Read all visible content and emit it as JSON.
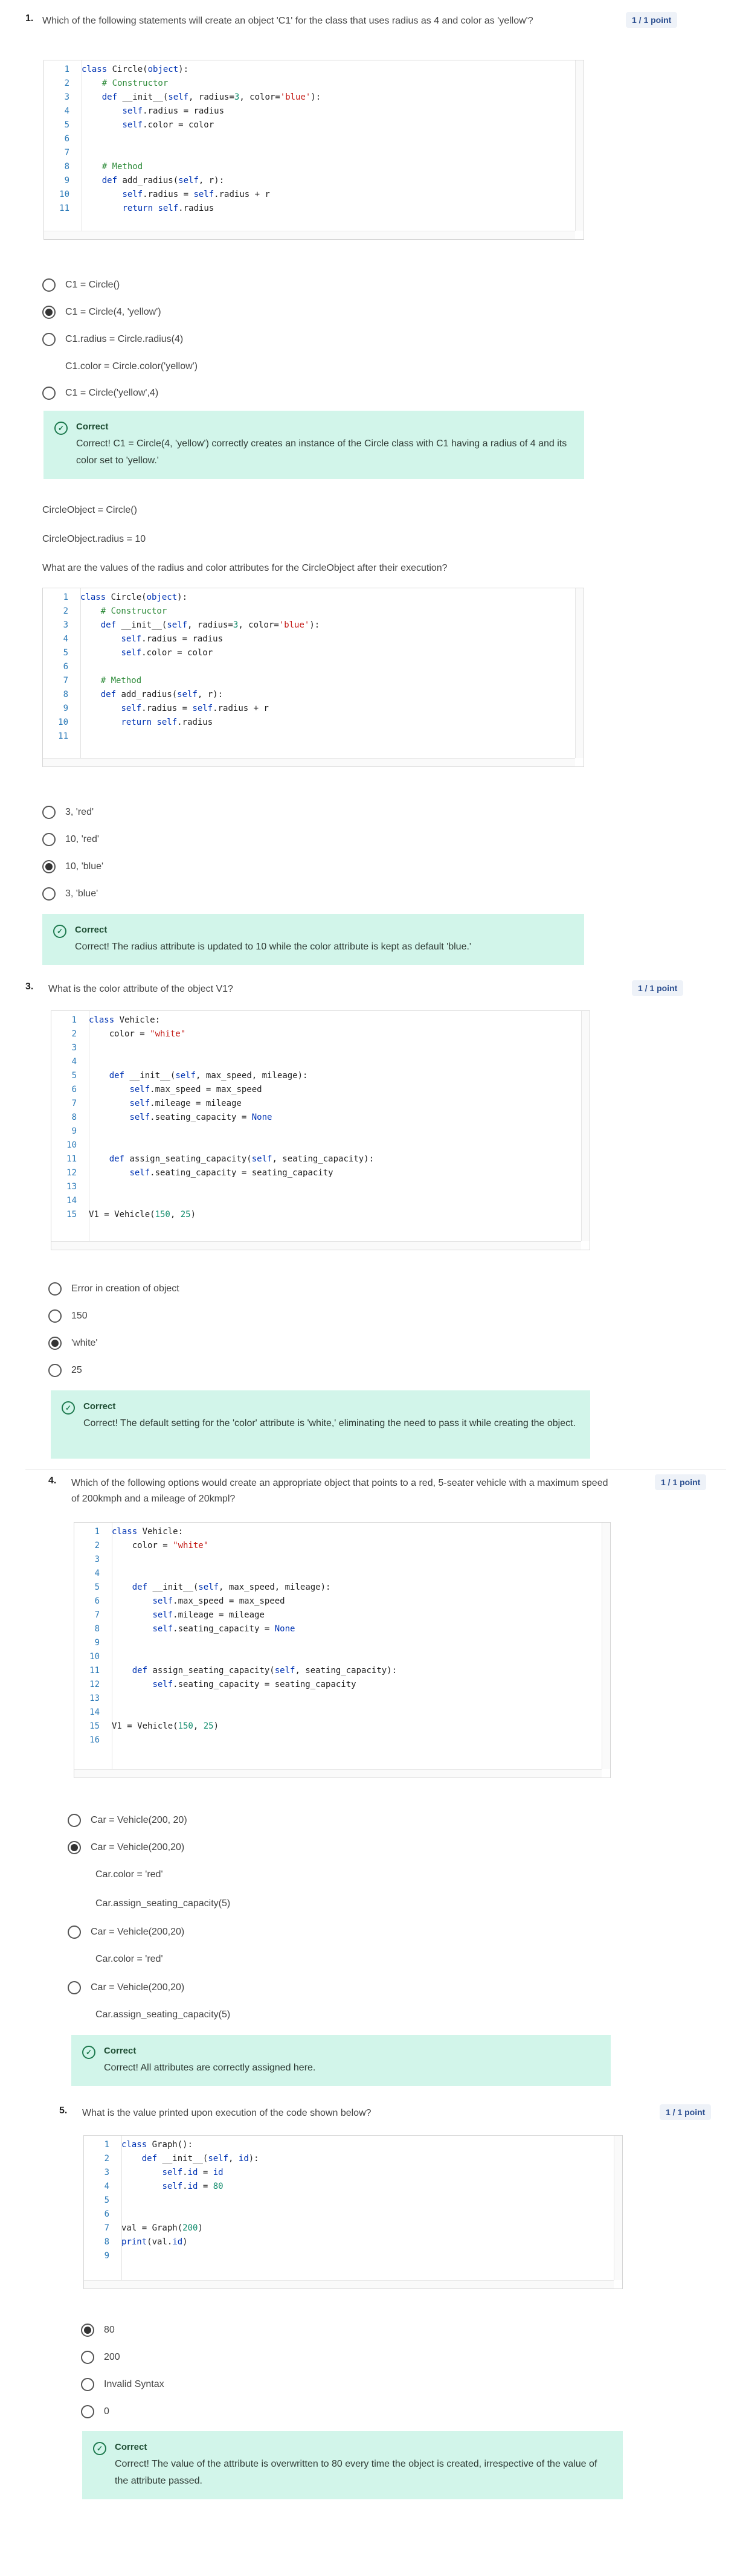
{
  "q1": {
    "text": "Which of the following statements will create an object 'C1' for the class that uses radius as 4 and color as 'yellow'?",
    "number": "1.",
    "points": "1 / 1 point",
    "options": [
      "C1 = Circle()",
      "C1 = Circle(4, 'yellow')",
      "C1.radius = Circle.radius(4)",
      "C1 = Circle('yellow',4)"
    ],
    "option_sub": "C1.color = Circle.color('yellow')",
    "selected_index": 1,
    "feedback_title": "Correct",
    "feedback_text": "Correct! C1 = Circle(4, 'yellow') correctly creates an instance of the Circle class with C1 having a radius of 4 and its color set to 'yellow.'"
  },
  "q2": {
    "pre_line1": "CircleObject = Circle()",
    "pre_line2": "CircleObject.radius = 10",
    "text": "What are the values of the radius and color attributes for the CircleObject after their execution?",
    "options": [
      "3, 'red'",
      "10, 'red'",
      "10, 'blue'",
      "3, 'blue'"
    ],
    "selected_index": 2,
    "feedback_title": "Correct",
    "feedback_text": "Correct! The radius attribute is updated to 10 while the color attribute is kept as default 'blue.'"
  },
  "q3": {
    "number": "3.",
    "text": "What is the color attribute of the object V1?",
    "points": "1 / 1 point",
    "options": [
      "Error in creation of object",
      "150",
      "'white'",
      "25"
    ],
    "selected_index": 2,
    "feedback_title": "Correct",
    "feedback_text": "Correct! The default setting for the 'color' attribute is 'white,' eliminating the need to pass it while creating the object."
  },
  "q4": {
    "number": "4.",
    "text": "Which of the following options would create an appropriate object that points to a red, 5-seater vehicle with a maximum speed of 200kmph and a mileage of 20kmpl?",
    "points": "1 / 1 point",
    "options": [
      "Car = Vehicle(200, 20)",
      "Car = Vehicle(200,20)",
      "Car = Vehicle(200,20)",
      "Car = Vehicle(200,20)"
    ],
    "opt2_sub1": "Car.color = 'red'",
    "opt2_sub2": "Car.assign_seating_capacity(5)",
    "opt3_sub1": "Car.color = 'red'",
    "opt4_sub1": "Car.assign_seating_capacity(5)",
    "selected_index": 1,
    "feedback_title": "Correct",
    "feedback_text": "Correct! All attributes are correctly assigned here."
  },
  "q5": {
    "number": "5.",
    "text": "What is the value printed upon execution of the code shown below?",
    "points": "1 / 1 point",
    "options": [
      "80",
      "200",
      "Invalid Syntax",
      "0"
    ],
    "selected_index": 0,
    "feedback_title": "Correct",
    "feedback_text": "Correct! The value of the attribute is overwritten to 80 every time the object is created, irrespective of the value of the attribute passed."
  },
  "code": {
    "circle1": [
      "1|<span class='kw'>class</span> Circle(<span class='kw'>object</span>):",
      "2|    <span class='cm'># Constructor</span>",
      "3|    <span class='kw'>def</span> __init__(<span class='sf'>self</span>, radius=<span class='nm'>3</span>, color=<span class='st'>'blue'</span>):",
      "4|        <span class='sf'>self</span>.radius = radius",
      "5|        <span class='sf'>self</span>.color = color",
      "6|",
      "7|",
      "8|    <span class='cm'># Method</span>",
      "9|    <span class='kw'>def</span> add_radius(<span class='sf'>self</span>, r):",
      "10|        <span class='sf'>self</span>.radius = <span class='sf'>self</span>.radius + r",
      "11|        <span class='kw'>return</span> <span class='sf'>self</span>.radius"
    ],
    "circle2": [
      "1|<span class='kw'>class</span> Circle(<span class='kw'>object</span>):",
      "2|    <span class='cm'># Constructor</span>",
      "3|    <span class='kw'>def</span> __init__(<span class='sf'>self</span>, radius=<span class='nm'>3</span>, color=<span class='st'>'blue'</span>):",
      "4|        <span class='sf'>self</span>.radius = radius",
      "5|        <span class='sf'>self</span>.color = color",
      "6|",
      "7|    <span class='cm'># Method</span>",
      "8|    <span class='kw'>def</span> add_radius(<span class='sf'>self</span>, r):",
      "9|        <span class='sf'>self</span>.radius = <span class='sf'>self</span>.radius + r",
      "10|        <span class='kw'>return</span> <span class='sf'>self</span>.radius",
      "11|"
    ],
    "vehicle1": [
      "1|<span class='kw'>class</span> Vehicle:",
      "2|    color = <span class='st'>\"white\"</span>",
      "3|",
      "4|",
      "5|    <span class='kw'>def</span> __init__(<span class='sf'>self</span>, max_speed, mileage):",
      "6|        <span class='sf'>self</span>.max_speed = max_speed",
      "7|        <span class='sf'>self</span>.mileage = mileage",
      "8|        <span class='sf'>self</span>.seating_capacity = <span class='kw'>None</span>",
      "9|",
      "10|",
      "11|    <span class='kw'>def</span> assign_seating_capacity(<span class='sf'>self</span>, seating_capacity):",
      "12|        <span class='sf'>self</span>.seating_capacity = seating_capacity",
      "13|",
      "14|",
      "15|V1 = Vehicle(<span class='nm'>150</span>, <span class='nm'>25</span>)"
    ],
    "vehicle2": [
      "1|<span class='kw'>class</span> Vehicle:",
      "2|    color = <span class='st'>\"white\"</span>",
      "3|",
      "4|",
      "5|    <span class='kw'>def</span> __init__(<span class='sf'>self</span>, max_speed, mileage):",
      "6|        <span class='sf'>self</span>.max_speed = max_speed",
      "7|        <span class='sf'>self</span>.mileage = mileage",
      "8|        <span class='sf'>self</span>.seating_capacity = <span class='kw'>None</span>",
      "9|",
      "10|",
      "11|    <span class='kw'>def</span> assign_seating_capacity(<span class='sf'>self</span>, seating_capacity):",
      "12|        <span class='sf'>self</span>.seating_capacity = seating_capacity",
      "13|",
      "14|",
      "15|V1 = Vehicle(<span class='nm'>150</span>, <span class='nm'>25</span>)",
      "16|"
    ],
    "graph": [
      "1|<span class='kw'>class</span> Graph():",
      "2|    <span class='kw'>def</span> __init__(<span class='sf'>self</span>, <span class='sf'>id</span>):",
      "3|        <span class='sf'>self</span>.<span class='sf'>id</span> = <span class='sf'>id</span>",
      "4|        <span class='sf'>self</span>.<span class='sf'>id</span> = <span class='nm'>80</span>",
      "5|",
      "6|",
      "7|val = Graph(<span class='nm'>200</span>)",
      "8|<span class='kw'>print</span>(val.<span class='sf'>id</span>)",
      "9|"
    ]
  },
  "icons": {
    "feedback": "check-circle-icon"
  },
  "colors": {
    "feedback_bg": "#d2f5ea",
    "points_bg": "#eef2f8",
    "line_number": "#2b7ab8"
  }
}
